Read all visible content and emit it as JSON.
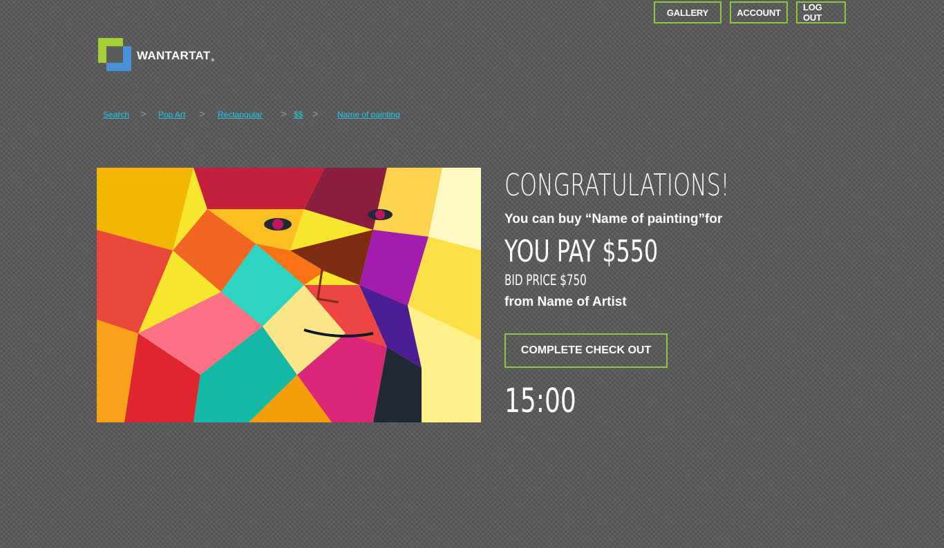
{
  "nav": {
    "gallery_label": "GALLERY",
    "account_label": "ACCOUNT",
    "logout_label": "LOG OUT"
  },
  "logo": {
    "text": "WANTARTAT",
    "reg": "®"
  },
  "breadcrumb": {
    "items": [
      "Search",
      "Pop Art",
      "Rectangular",
      "$$",
      "Name of painting"
    ],
    "separator": ">"
  },
  "painting": {
    "alt": "Colorful geometric pop art portrait of a man"
  },
  "purchase": {
    "headline": "CONGRATULATIONS!",
    "subtitle": "You can buy “Name of painting”for",
    "price_line": "YOU PAY $550",
    "bid_line": "BID PRICE $750",
    "artist_line": "from Name of Artist",
    "checkout_label": "COMPLETE CHECK OUT",
    "timer": "15:00"
  },
  "colors": {
    "accent": "#8cc63f",
    "link": "#29c4e8",
    "background": "#5b5b5b",
    "logo_green": "#a6ce39",
    "logo_blue": "#4a90d9"
  }
}
